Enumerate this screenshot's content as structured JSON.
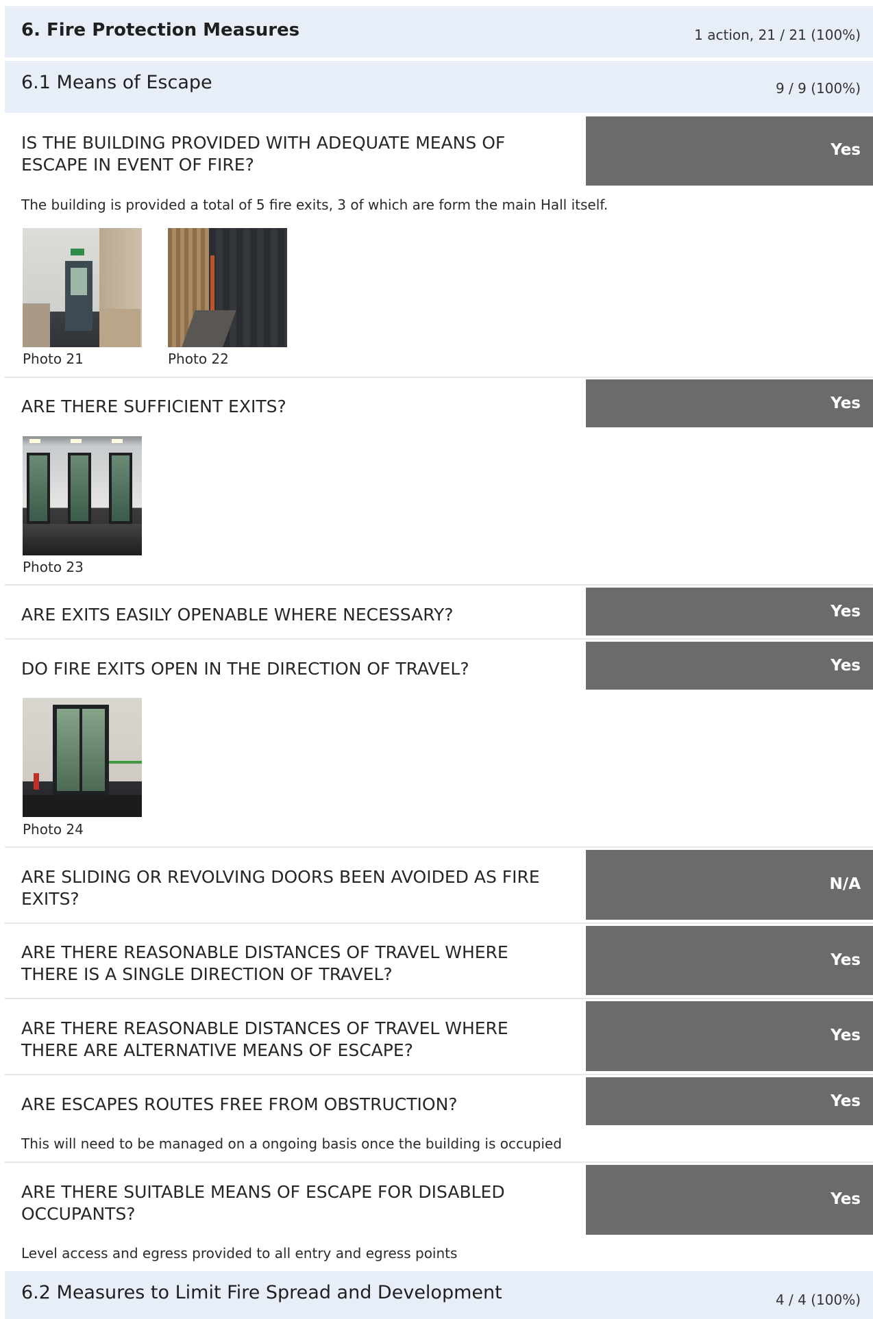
{
  "section": {
    "title": "6. Fire Protection Measures",
    "score": "1 action, 21 / 21 (100%)"
  },
  "subsection_1": {
    "title": "6.1 Means of Escape",
    "score": "9 / 9 (100%)"
  },
  "questions": [
    {
      "question": "IS THE BUILDING PROVIDED WITH ADEQUATE MEANS OF ESCAPE IN EVENT OF FIRE?",
      "answer": "Yes",
      "note": "The building is provided a total of 5 fire exits, 3 of which are form the main Hall itself.",
      "photos": [
        "Photo 21",
        "Photo 22"
      ]
    },
    {
      "question": "ARE THERE SUFFICIENT EXITS?",
      "answer": "Yes",
      "photos": [
        "Photo 23"
      ]
    },
    {
      "question": "ARE EXITS EASILY OPENABLE WHERE NECESSARY?",
      "answer": "Yes"
    },
    {
      "question": "DO FIRE EXITS OPEN IN THE DIRECTION OF TRAVEL?",
      "answer": "Yes",
      "photos": [
        "Photo 24"
      ]
    },
    {
      "question": "ARE SLIDING OR REVOLVING DOORS BEEN AVOIDED AS FIRE EXITS?",
      "answer": "N/A"
    },
    {
      "question": "ARE THERE REASONABLE DISTANCES OF TRAVEL WHERE THERE IS A SINGLE DIRECTION OF TRAVEL?",
      "answer": "Yes"
    },
    {
      "question": "ARE THERE REASONABLE DISTANCES OF TRAVEL WHERE THERE ARE ALTERNATIVE MEANS OF ESCAPE?",
      "answer": "Yes"
    },
    {
      "question": "ARE ESCAPES ROUTES FREE FROM OBSTRUCTION?",
      "answer": "Yes",
      "note": "This will need to be managed on a ongoing basis once the building is occupied"
    },
    {
      "question": "ARE THERE SUITABLE MEANS OF ESCAPE FOR DISABLED OCCUPANTS?",
      "answer": "Yes",
      "note": "Level access and egress provided to all entry and egress points"
    }
  ],
  "subsection_2": {
    "title": "6.2 Measures to Limit Fire Spread and Development",
    "score": "4 / 4 (100%)"
  },
  "colors": {
    "header_bg": "#e8eef7",
    "answer_bg": "#6b6b6b",
    "answer_text": "#ffffff"
  }
}
